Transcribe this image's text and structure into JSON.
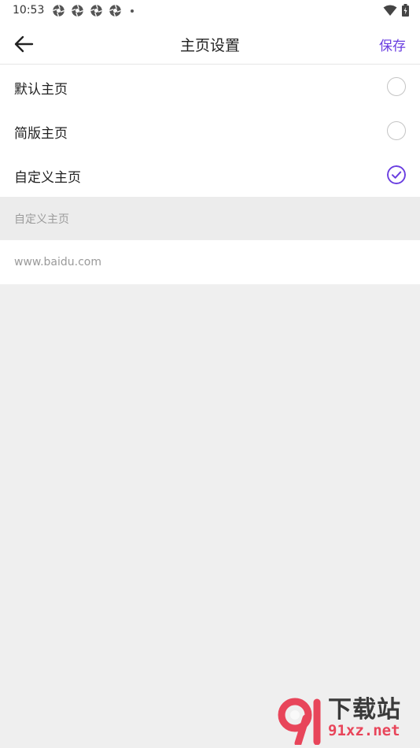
{
  "status_bar": {
    "time": "10:53",
    "notification_icons": [
      "aperture-icon",
      "aperture-icon",
      "aperture-icon",
      "aperture-icon"
    ],
    "right_icons": [
      "wifi-icon",
      "battery-icon"
    ]
  },
  "toolbar": {
    "back_icon": "arrow-left-icon",
    "title": "主页设置",
    "save_label": "保存"
  },
  "options": [
    {
      "label": "默认主页",
      "selected": false
    },
    {
      "label": "简版主页",
      "selected": false
    },
    {
      "label": "自定义主页",
      "selected": true
    }
  ],
  "custom_section": {
    "header": "自定义主页",
    "url_value": "www.baidu.com"
  },
  "watermark": {
    "title": "下载站",
    "url": "91xz.net"
  },
  "colors": {
    "accent": "#6a3ee0",
    "background": "#efefef",
    "watermark_red": "#e8455a"
  }
}
